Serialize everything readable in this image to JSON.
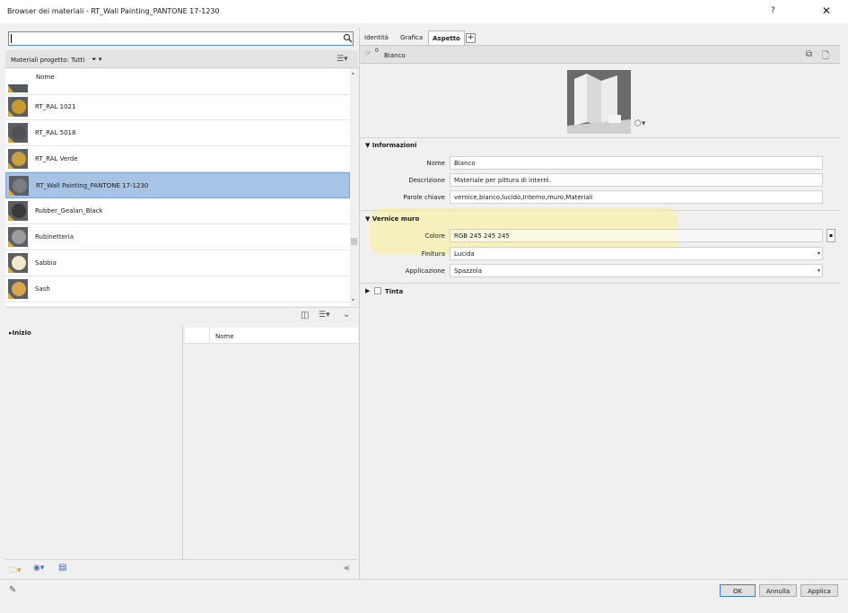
{
  "window": {
    "title": "Browser dei materiali - RT_Wall Painting_PANTONE 17-1230",
    "help": "?",
    "close": "✕"
  },
  "left": {
    "search": {
      "value": "",
      "placeholder": ""
    },
    "filter_label": "Materiali progetto: Tutti",
    "list_header": "Nome",
    "materials": [
      {
        "name": "RT_RAL 1021",
        "thumb": "#c99b2e",
        "selected": false
      },
      {
        "name": "RT_RAL 5018",
        "thumb": "#4e5257",
        "selected": false
      },
      {
        "name": "RT_RAL Verde",
        "thumb": "#c9a13a",
        "selected": false
      },
      {
        "name": "RT_Wall Painting_PANTONE 17-1230",
        "thumb": "#7a7d83",
        "selected": true
      },
      {
        "name": "Rubber_Gealan_Black",
        "thumb": "#3a3a3a",
        "selected": false
      },
      {
        "name": "Rubinetteria",
        "thumb": "#9c9c9c",
        "selected": false
      },
      {
        "name": "Sabbia",
        "thumb": "#f2e9c8",
        "selected": false
      },
      {
        "name": "Sash",
        "thumb": "#d8a64b",
        "selected": false
      }
    ],
    "library_tree_root": "▸Inizio",
    "library_table_header": "Nome"
  },
  "right": {
    "tabs": [
      {
        "label": "Identità"
      },
      {
        "label": "Grafica"
      },
      {
        "label": "Aspetto",
        "active": true
      }
    ],
    "tab_add": "+",
    "asset_name": "Bianco",
    "sections": {
      "info": {
        "title": "▼ Informazioni",
        "rows": [
          {
            "label": "Nome",
            "value": "Bianco"
          },
          {
            "label": "Descrizione",
            "value": "Materiale per pittura di interni."
          },
          {
            "label": "Parole chiave",
            "value": "vernice,bianco,lucido,Interno,muro,Materiali"
          }
        ]
      },
      "wall_paint": {
        "title": "▼ Vernice muro",
        "rows": [
          {
            "label": "Colore",
            "value": "RGB 245 245 245"
          },
          {
            "label": "Finitura",
            "value": "Lucida"
          },
          {
            "label": "Applicazione",
            "value": "Spazzola"
          }
        ]
      },
      "tint": {
        "title": "Tinta"
      }
    }
  },
  "footer": {
    "ok": "OK",
    "cancel": "Annulla",
    "apply": "Applica"
  },
  "colors": {
    "selection": "#a7c4e6",
    "highlight": "#faf096",
    "accent": "#3c7fd1"
  }
}
